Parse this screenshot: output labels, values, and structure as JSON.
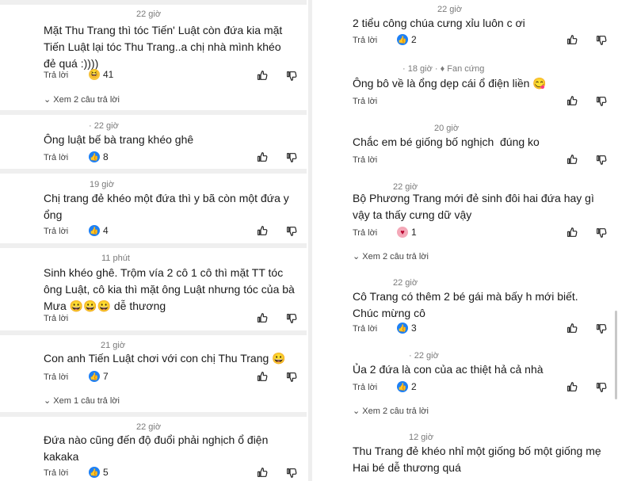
{
  "left": [
    {
      "time": "22 giờ",
      "text": "Mặt Thu Trang thì tóc Tiến' Luật còn đứa kia mặt Tiến Luật lại tóc Thu Trang..a chị nhà mình khéo đẻ quá :))))",
      "reply": "Trả lời",
      "reaction": "haha",
      "count": "41",
      "more": "Xem 2 câu trả lời"
    },
    {
      "time": "22 giờ",
      "text": "Ông luật bế bà trang khéo ghê",
      "reply": "Trả lời",
      "reaction": "like",
      "count": "8"
    },
    {
      "time": "19 giờ",
      "text": "Chị trang đẻ khéo một đứa thì y bã còn một đứa y ổng",
      "reply": "Trả lời",
      "reaction": "like",
      "count": "4"
    },
    {
      "time": "11 phút",
      "text": "Sinh khéo ghê. Trộm vía 2 cô 1 cô thì mặt TT tóc ông Luật, cô kia thì mặt ông Luật nhưng tóc của bà Mưa 😀😀😀 dễ thương",
      "reply": "Trả lời"
    },
    {
      "time": "21 giờ",
      "text": "Con anh Tiến Luật chơi với con chị Thu Trang 😀",
      "reply": "Trả lời",
      "reaction": "like",
      "count": "7",
      "more": "Xem 1 câu trả lời"
    },
    {
      "time": "22 giờ",
      "text": "Đứa nào cũng đến độ đuổi phải nghịch ổ điện kakaka",
      "reply": "Trả lời",
      "reaction": "like",
      "count": "5"
    }
  ],
  "right": [
    {
      "time": "22 giờ",
      "text": "2 tiểu công chúa cưng xỉu luôn c ơi",
      "reply": "Trả lời",
      "reaction": "like",
      "count": "2"
    },
    {
      "time": "18 giờ",
      "badge": "Fan cứng",
      "text": "Ông bô về là ổng dẹp cái ổ điện liền 😋",
      "reply": "Trả lời"
    },
    {
      "time": "20 giờ",
      "text": "Chắc em bé giống bố nghịch  đúng ko",
      "reply": "Trả lời"
    },
    {
      "time": "22 giờ",
      "text": "Bộ Phương Trang mới đẻ sinh đôi hai đứa hay gì vậy ta thấy cưng dữ vậy",
      "reply": "Trả lời",
      "reaction": "love",
      "count": "1",
      "more": "Xem 2 câu trả lời"
    },
    {
      "time": "22 giờ",
      "text": "Cô Trang có thêm 2 bé gái mà bấy h mới biết. Chúc mừng cô",
      "reply": "Trả lời",
      "reaction": "like",
      "count": "3"
    },
    {
      "time": "22 giờ",
      "text": "Ủa 2 đứa là con của ac thiệt hả cả nhà",
      "reply": "Trả lời",
      "reaction": "like",
      "count": "2",
      "more": "Xem 2 câu trả lời"
    },
    {
      "time": "12 giờ",
      "text": "Thu Trang đẻ khéo nhỉ một giống bố một giống mẹ Hai bé dễ thương quá"
    }
  ]
}
